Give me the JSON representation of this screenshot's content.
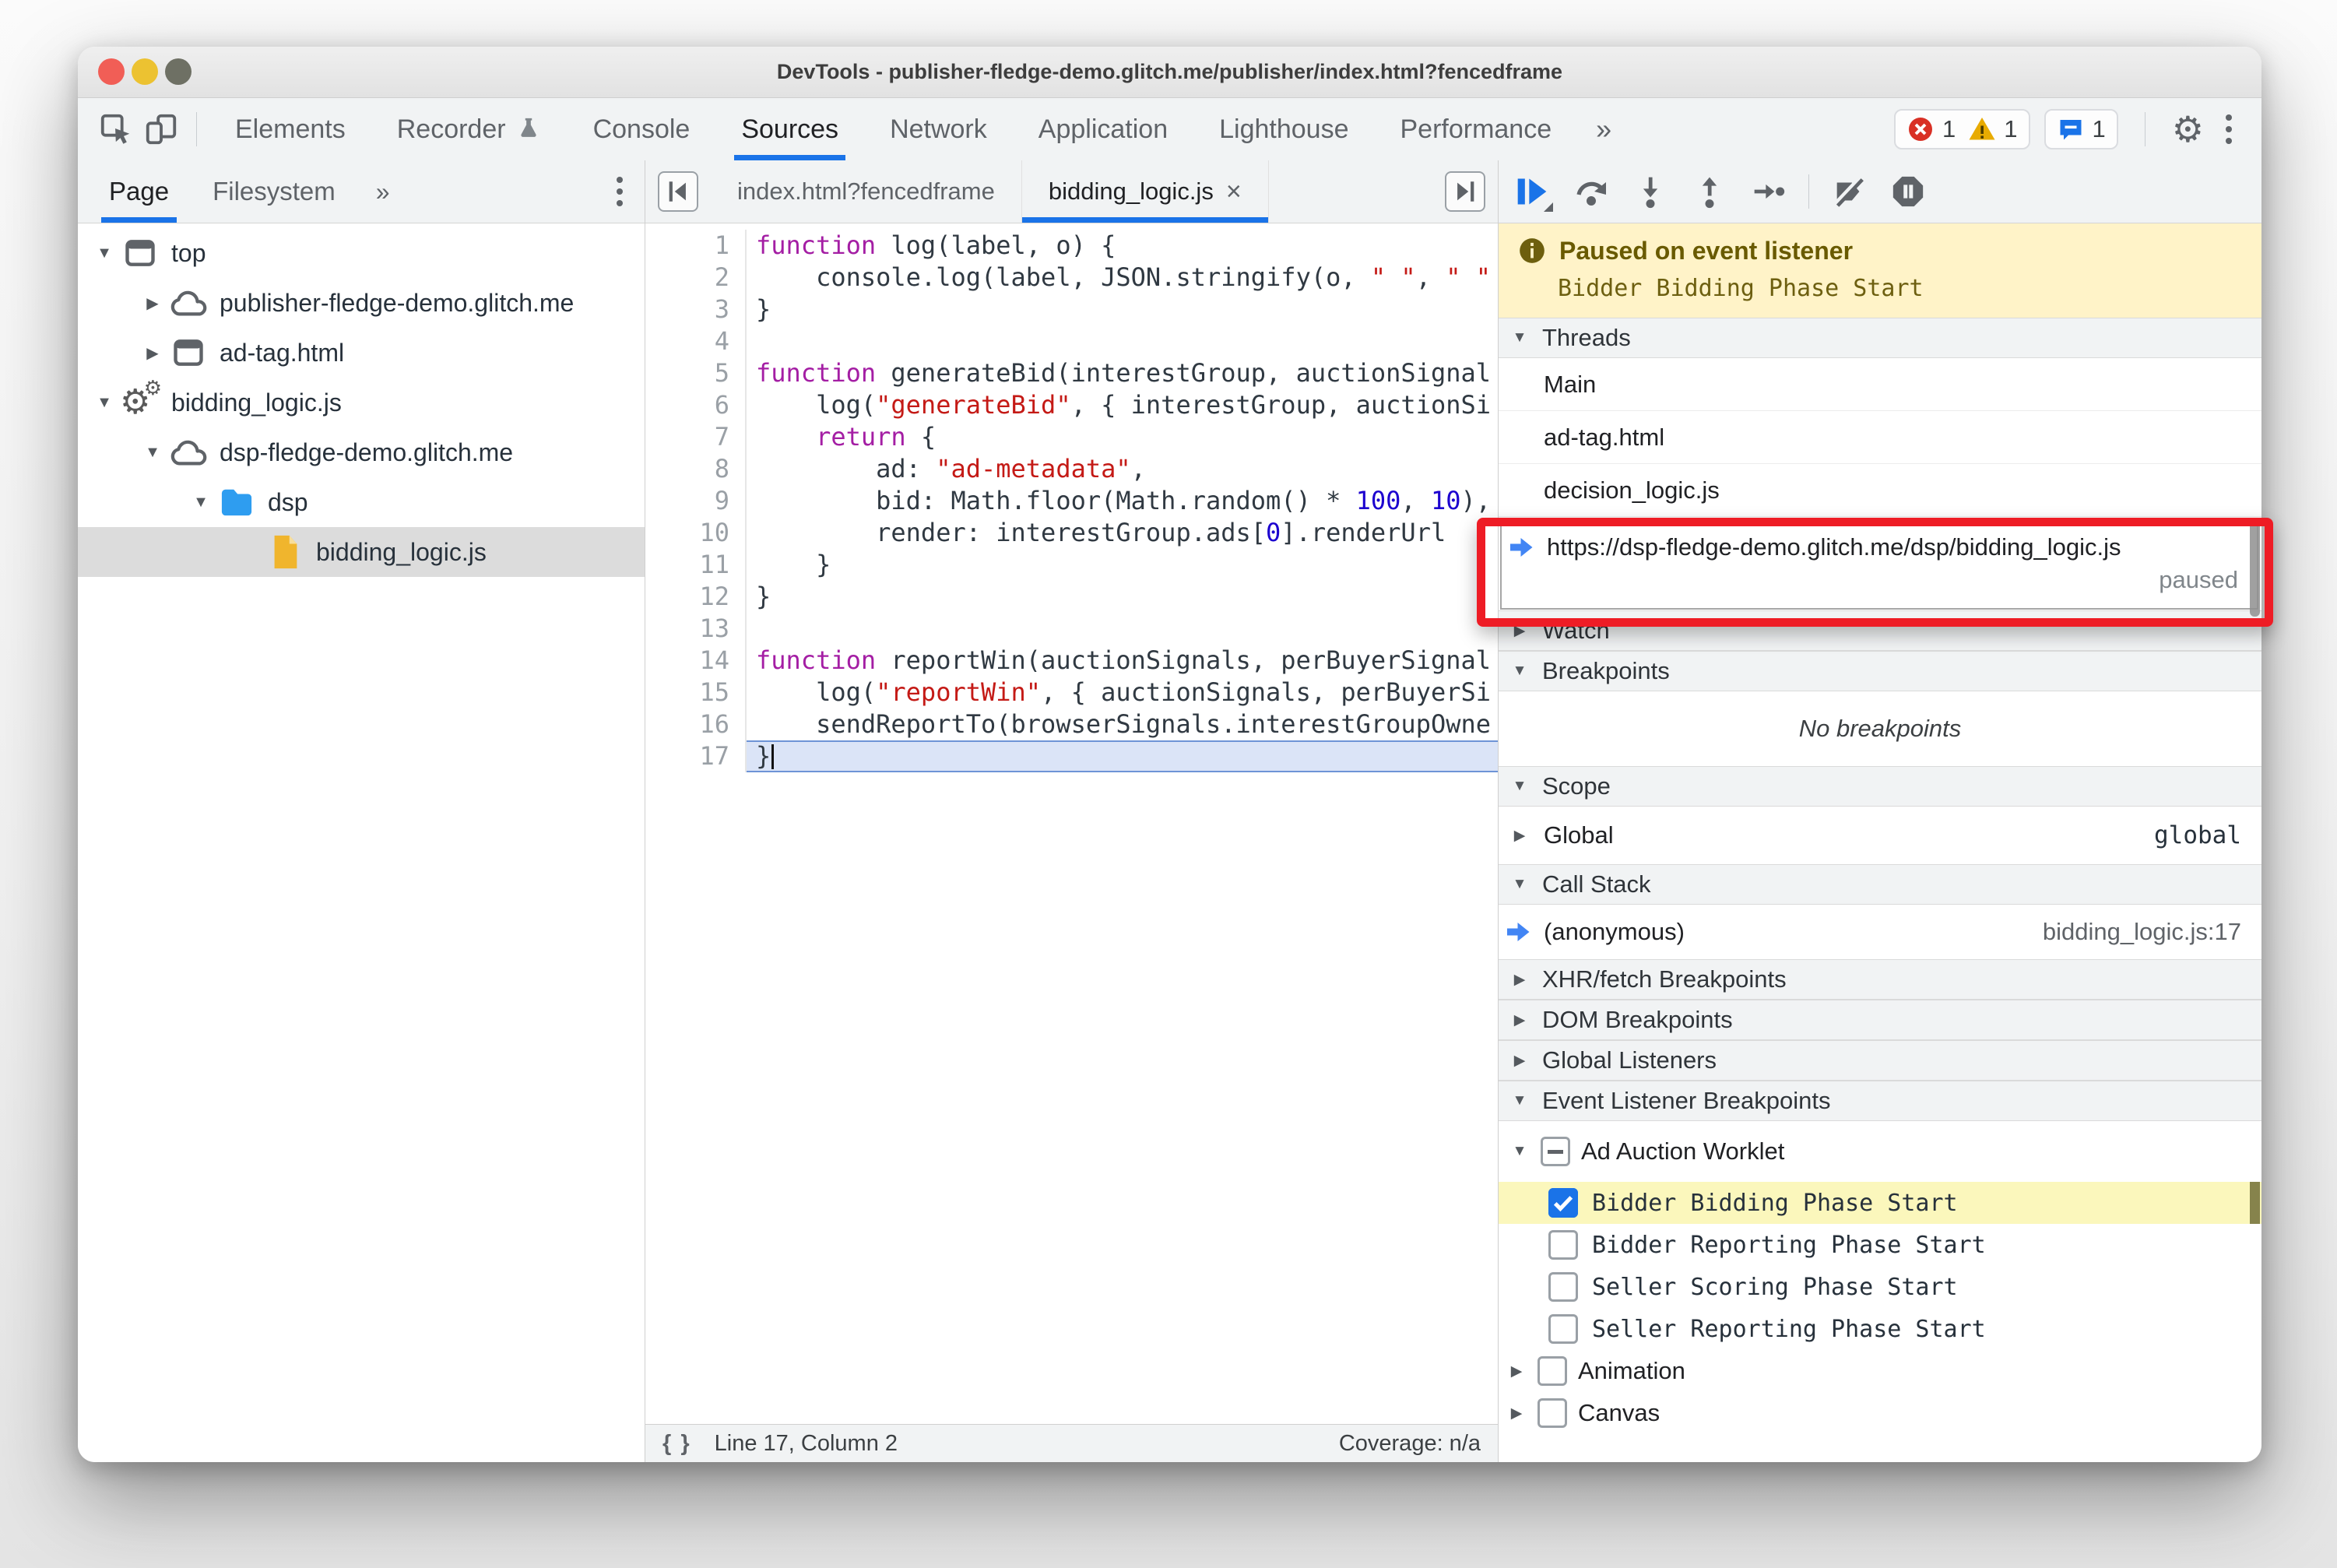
{
  "window": {
    "title": "DevTools - publisher-fledge-demo.glitch.me/publisher/index.html?fencedframe"
  },
  "toolbar": {
    "tabs": [
      {
        "label": "Elements",
        "active": false
      },
      {
        "label": "Recorder",
        "active": false,
        "icon": "flask"
      },
      {
        "label": "Console",
        "active": false
      },
      {
        "label": "Sources",
        "active": true
      },
      {
        "label": "Network",
        "active": false
      },
      {
        "label": "Application",
        "active": false
      },
      {
        "label": "Lighthouse",
        "active": false
      },
      {
        "label": "Performance",
        "active": false
      }
    ],
    "more_label": "»",
    "badges": {
      "errors": "1",
      "warnings": "1",
      "issues": "1"
    }
  },
  "navigator": {
    "tabs": [
      {
        "label": "Page",
        "active": true
      },
      {
        "label": "Filesystem",
        "active": false
      }
    ],
    "more_label": "»",
    "tree": [
      {
        "label": "top",
        "icon": "frame",
        "expander": "down",
        "indent": 0
      },
      {
        "label": "publisher-fledge-demo.glitch.me",
        "icon": "cloud",
        "expander": "right",
        "indent": 1
      },
      {
        "label": "ad-tag.html",
        "icon": "frame",
        "expander": "right",
        "indent": 1
      },
      {
        "label": "bidding_logic.js",
        "icon": "worker",
        "expander": "down",
        "indent": 0
      },
      {
        "label": "dsp-fledge-demo.glitch.me",
        "icon": "cloud",
        "expander": "down",
        "indent": 1
      },
      {
        "label": "dsp",
        "icon": "folder",
        "expander": "down",
        "indent": 2
      },
      {
        "label": "bidding_logic.js",
        "icon": "file",
        "expander": "none",
        "indent": 3,
        "selected": true
      }
    ]
  },
  "editor": {
    "tabs": [
      {
        "label": "index.html?fencedframe",
        "active": false,
        "closable": false
      },
      {
        "label": "bidding_logic.js",
        "active": true,
        "closable": true
      }
    ],
    "close_label": "×",
    "current_line": 17,
    "lines": [
      [
        {
          "c": "k",
          "t": "function"
        },
        {
          "c": "d",
          "t": " log(label, o) {"
        }
      ],
      [
        {
          "c": "d",
          "t": "    console.log(label, JSON.stringify(o, "
        },
        {
          "c": "s",
          "t": "\" \""
        },
        {
          "c": "d",
          "t": ", "
        },
        {
          "c": "s",
          "t": "\" \""
        }
      ],
      [
        {
          "c": "d",
          "t": "}"
        }
      ],
      [],
      [
        {
          "c": "k",
          "t": "function"
        },
        {
          "c": "d",
          "t": " generateBid(interestGroup, auctionSignal"
        }
      ],
      [
        {
          "c": "d",
          "t": "    log("
        },
        {
          "c": "s",
          "t": "\"generateBid\""
        },
        {
          "c": "d",
          "t": ", { interestGroup, auctionSi"
        }
      ],
      [
        {
          "c": "d",
          "t": "    "
        },
        {
          "c": "k",
          "t": "return"
        },
        {
          "c": "d",
          "t": " {"
        }
      ],
      [
        {
          "c": "d",
          "t": "        ad: "
        },
        {
          "c": "s",
          "t": "\"ad-metadata\""
        },
        {
          "c": "d",
          "t": ","
        }
      ],
      [
        {
          "c": "d",
          "t": "        bid: Math.floor(Math.random() * "
        },
        {
          "c": "n",
          "t": "100"
        },
        {
          "c": "d",
          "t": ", "
        },
        {
          "c": "n",
          "t": "10"
        },
        {
          "c": "d",
          "t": "),"
        }
      ],
      [
        {
          "c": "d",
          "t": "        render: interestGroup.ads["
        },
        {
          "c": "n",
          "t": "0"
        },
        {
          "c": "d",
          "t": "].renderUrl"
        }
      ],
      [
        {
          "c": "d",
          "t": "    }"
        }
      ],
      [
        {
          "c": "d",
          "t": "}"
        }
      ],
      [],
      [
        {
          "c": "k",
          "t": "function"
        },
        {
          "c": "d",
          "t": " reportWin(auctionSignals, perBuyerSignal"
        }
      ],
      [
        {
          "c": "d",
          "t": "    log("
        },
        {
          "c": "s",
          "t": "\"reportWin\""
        },
        {
          "c": "d",
          "t": ", { auctionSignals, perBuyerSi"
        }
      ],
      [
        {
          "c": "d",
          "t": "    sendReportTo(browserSignals.interestGroupOwne"
        }
      ],
      [
        {
          "c": "d",
          "t": "}"
        }
      ]
    ],
    "status": {
      "braces": "{ }",
      "line_col": "Line 17, Column 2",
      "coverage": "Coverage: n/a"
    }
  },
  "debugger": {
    "paused_banner": {
      "title": "Paused on event listener",
      "detail": "Bidder Bidding Phase Start"
    },
    "threads": {
      "title": "Threads",
      "items": [
        {
          "label": "Main"
        },
        {
          "label": "ad-tag.html"
        },
        {
          "label": "decision_logic.js"
        }
      ],
      "selected": {
        "label": "https://dsp-fledge-demo.glitch.me/dsp/bidding_logic.js",
        "status": "paused"
      }
    },
    "watch": {
      "title": "Watch"
    },
    "breakpoints": {
      "title": "Breakpoints",
      "empty": "No breakpoints"
    },
    "scope": {
      "title": "Scope",
      "row": {
        "label": "Global",
        "value": "global"
      }
    },
    "call_stack": {
      "title": "Call Stack",
      "row": {
        "label": "(anonymous)",
        "location": "bidding_logic.js:17"
      }
    },
    "collapsed_sections": [
      "XHR/fetch Breakpoints",
      "DOM Breakpoints",
      "Global Listeners"
    ],
    "event_listener_breakpoints": {
      "title": "Event Listener Breakpoints",
      "group": {
        "label": "Ad Auction Worklet",
        "state": "indeterminate"
      },
      "items": [
        {
          "label": "Bidder Bidding Phase Start",
          "checked": true,
          "highlighted": true
        },
        {
          "label": "Bidder Reporting Phase Start",
          "checked": false,
          "highlighted": false
        },
        {
          "label": "Seller Scoring Phase Start",
          "checked": false,
          "highlighted": false
        },
        {
          "label": "Seller Reporting Phase Start",
          "checked": false,
          "highlighted": false
        }
      ],
      "categories": [
        {
          "label": "Animation"
        },
        {
          "label": "Canvas"
        }
      ]
    }
  },
  "colors": {
    "accent_blue": "#1a73e8",
    "exec_arrow_blue": "#4285f4",
    "paused_banner_bg": "#fff3c8",
    "paused_banner_text": "#695a00",
    "selected_breakpoint_bg": "#fbf7bc",
    "exec_line_bg": "#dbe4f7",
    "error_red": "#d93025",
    "warning_yellow": "#e0a800",
    "highlight_red_box": "#ee1c25",
    "keyword": "#a41ea4",
    "string": "#c41a16",
    "number": "#1c00cf",
    "folder_blue": "#2196f3",
    "file_yellow": "#f2bb30"
  }
}
